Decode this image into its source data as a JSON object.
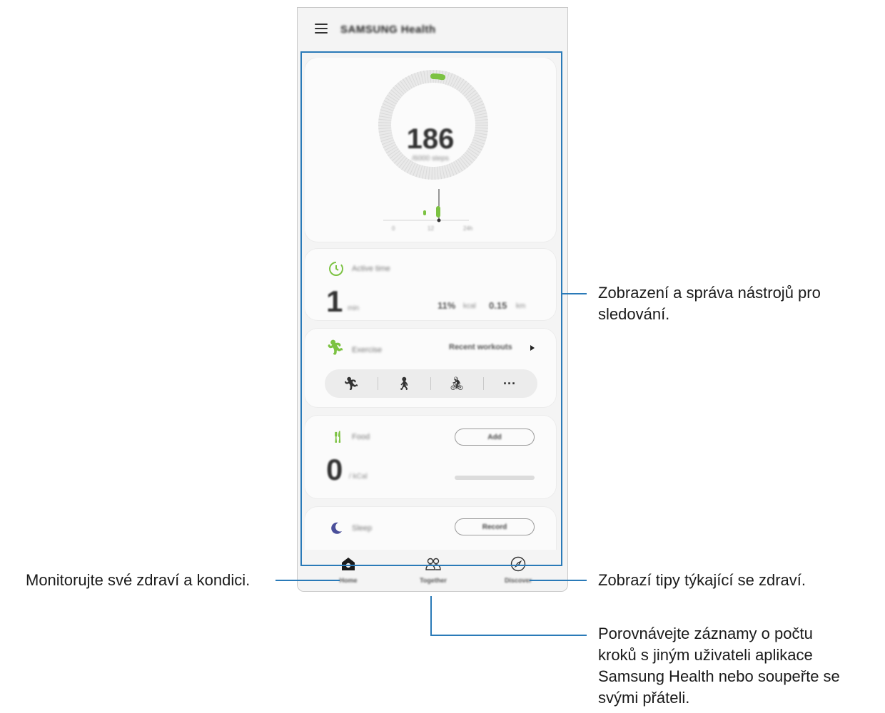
{
  "app": {
    "title": "SAMSUNG Health"
  },
  "steps_card": {
    "value": "186",
    "subtitle": "/6000 steps",
    "goal": 6000,
    "ring_progress_fraction": 0.031,
    "chart_labels": [
      "0",
      "12",
      "24h"
    ]
  },
  "active_card": {
    "title": "Active time",
    "minutes_value": "1",
    "minutes_unit": "min",
    "kcal_value": "11%",
    "kcal_unit": "kcal",
    "distance_value": "0.15",
    "distance_unit": "km"
  },
  "exercise_card": {
    "title": "Exercise",
    "recent_link": "Recent workouts",
    "quick_items": [
      "running-icon",
      "walking-icon",
      "cycling-icon",
      "more-icon"
    ],
    "more_symbol": "···"
  },
  "food_card": {
    "title": "Food",
    "add_button": "Add",
    "value": "0",
    "unit": "/ kCal",
    "progress_fraction": 0
  },
  "sleep_card": {
    "title": "Sleep",
    "record_button": "Record"
  },
  "bottom_nav": {
    "items": [
      {
        "label": "Home",
        "icon": "home-icon"
      },
      {
        "label": "Together",
        "icon": "people-icon"
      },
      {
        "label": "Discover",
        "icon": "compass-icon"
      }
    ]
  },
  "callouts": {
    "trackers": [
      "Zobrazení a správa nástrojů pro",
      "sledování."
    ],
    "home": "Monitorujte své zdraví a kondici.",
    "discover": "Zobrazí tipy týkající se zdraví.",
    "together": [
      "Porovnávejte záznamy o počtu",
      "kroků s jiným uživateli aplikace",
      "Samsung Health nebo soupeřte se",
      "svými přáteli."
    ]
  },
  "colors": {
    "accent_green": "#7cc242",
    "callout_blue": "#2a7ab8",
    "sleep_moon": "#4a4f9a"
  }
}
